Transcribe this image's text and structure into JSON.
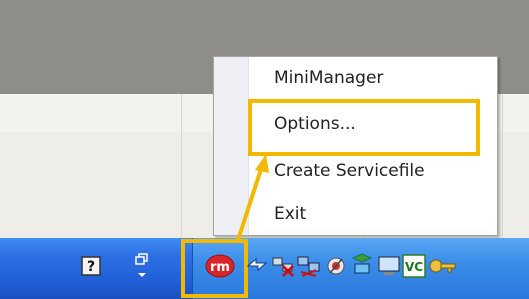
{
  "context_menu": {
    "items": [
      {
        "label": "MiniManager"
      },
      {
        "label": "Options..."
      },
      {
        "label": "Create Servicefile"
      },
      {
        "label": "Exit"
      }
    ]
  },
  "tray_icons": [
    "help-icon",
    "window-restore-icon",
    "rm-app-icon",
    "arrows-icon",
    "network-disconnected-icon",
    "network-status-icon",
    "security-icon",
    "network-connection-icon",
    "display-icon",
    "vc-icon",
    "key-icon"
  ],
  "rm_icon_text": "rm",
  "vc_icon_text": "VC",
  "colors": {
    "highlight": "#f2b900",
    "taskbar_blue": "#2563d9",
    "menu_bg": "#ffffff"
  }
}
